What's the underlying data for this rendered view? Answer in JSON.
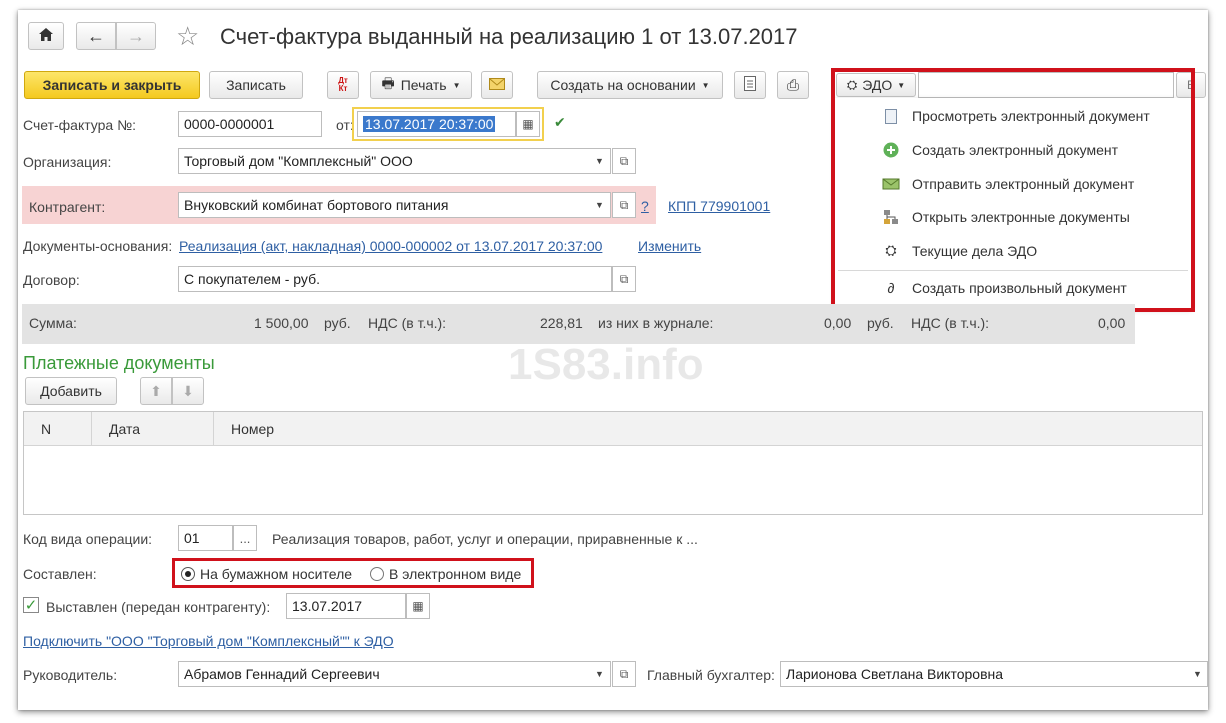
{
  "window": {
    "title": "Счет-фактура выданный на реализацию 1 от 13.07.2017",
    "home_icon": "home-icon",
    "star_icon": "star-icon"
  },
  "toolbar": {
    "save_close": "Записать и закрыть",
    "save": "Записать",
    "dt_kt_icon": "Дт Кт",
    "print": "Печать",
    "create_based": "Создать на основании",
    "edo": "ЭДО"
  },
  "edo_menu": {
    "items": [
      "Просмотреть электронный документ",
      "Создать электронный документ",
      "Отправить электронный документ",
      "Открыть электронные документы",
      "Текущие дела ЭДО",
      "Создать произвольный документ"
    ],
    "highlight_color": "#d0111b"
  },
  "form": {
    "invoice_no_label": "Счет-фактура №:",
    "invoice_no": "0000-0000001",
    "from_label": "от:",
    "date": "13.07.2017 20:37:00",
    "org_label": "Организация:",
    "org": "Торговый дом \"Комплексный\" ООО",
    "contractor_label": "Контрагент:",
    "contractor": "Внуковский комбинат бортового питания",
    "help": "?",
    "kpp": "КПП 779901001",
    "docs_label": "Документы-основания:",
    "docs_link": "Реализация (акт, накладная) 0000-000002 от 13.07.2017 20:37:00",
    "change_link": "Изменить",
    "contract_label": "Договор:",
    "contract": "С покупателем - руб."
  },
  "summary": {
    "sum_label": "Сумма:",
    "sum": "1 500,00",
    "currency1": "руб.",
    "vat_label1": "НДС (в т.ч.):",
    "vat1": "228,81",
    "journal_label": "из них в журнале:",
    "journal_sum": "0,00",
    "currency2": "руб.",
    "vat_label2": "НДС (в т.ч.):",
    "vat2": "0,00"
  },
  "watermark": "1S83.info",
  "payments": {
    "title": "Платежные документы",
    "add": "Добавить",
    "columns": [
      "N",
      "Дата",
      "Номер"
    ]
  },
  "operation": {
    "code_label": "Код вида операции:",
    "code": "01",
    "code_btn": "...",
    "description": "Реализация товаров, работ, услуг и операции, приравненные к ..."
  },
  "composed": {
    "label": "Составлен:",
    "paper": "На бумажном носителе",
    "electronic": "В электронном виде"
  },
  "issued": {
    "label": "Выставлен (передан контрагенту):",
    "date": "13.07.2017"
  },
  "connect_link": "Подключить \"ООО \"Торговый дом \"Комплексный\"\" к ЭДО",
  "head": {
    "label": "Руководитель:",
    "value": "Абрамов Геннадий Сергеевич",
    "chief_label": "Главный бухгалтер:",
    "chief": "Ларионова Светлана Викторовна"
  }
}
